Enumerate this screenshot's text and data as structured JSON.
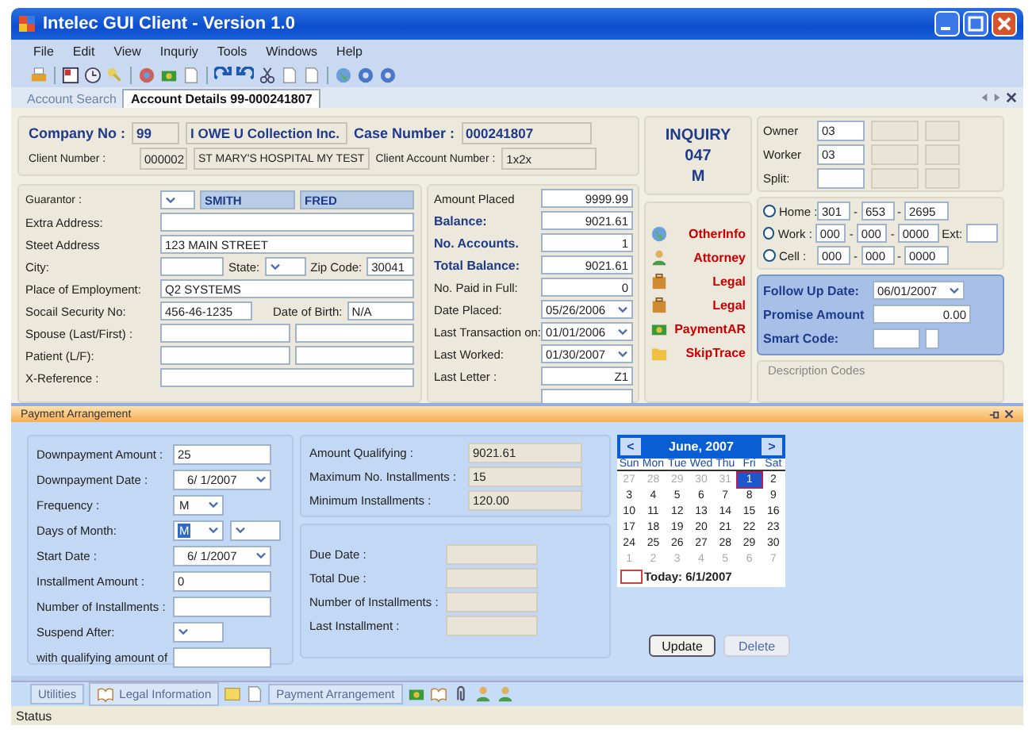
{
  "window": {
    "title": "Intelec GUI Client - Version 1.0"
  },
  "menu": [
    "File",
    "Edit",
    "View",
    "Inquriy",
    "Tools",
    "Windows",
    "Help"
  ],
  "tabs": [
    {
      "label": "Account Search",
      "selected": false
    },
    {
      "label": "Account Details 99-000241807",
      "selected": true
    }
  ],
  "header": {
    "company_label": "Company No :",
    "company_no": "99",
    "company_name": "I OWE U Collection Inc.",
    "case_label": "Case Number :",
    "case_number": "000241807",
    "client_label": "Client Number :",
    "client_number": "000002",
    "client_name": "ST MARY'S HOSPITAL  MY TEST",
    "client_account_label": "Client Account Number :",
    "client_account": "1x2x"
  },
  "guarantor": {
    "label": "Guarantor :",
    "last": "SMITH",
    "first": "FRED"
  },
  "address": [
    {
      "kind": "text",
      "label": "Extra Address:"
    },
    {
      "kind": "text",
      "label": "Steet Address",
      "value": "123 MAIN STREET"
    },
    {
      "kind": "city",
      "label": "City:",
      "state_label": "State:",
      "zip_label": "Zip Code:",
      "zip": "30041"
    },
    {
      "kind": "text",
      "label": "Place of Employment:",
      "value": "Q2 SYSTEMS"
    },
    {
      "kind": "ssn",
      "label": "Socail Security No:",
      "value": "456-46-1235",
      "dob_label": "Date of Birth:",
      "dob": "N/A"
    },
    {
      "kind": "pair",
      "label": "Spouse (Last/First) :"
    },
    {
      "kind": "pair",
      "label": "Patient (L/F):"
    },
    {
      "kind": "text",
      "label": "X-Reference :"
    }
  ],
  "amounts": [
    {
      "kind": "text",
      "label": "Amount Placed",
      "value": "9999.99",
      "emphasis": false
    },
    {
      "kind": "text",
      "label": "Balance:",
      "value": "9021.61",
      "emphasis": true
    },
    {
      "kind": "text",
      "label": "No. Accounts.",
      "value": "1",
      "emphasis": true
    },
    {
      "kind": "text",
      "label": "Total Balance:",
      "value": "9021.61",
      "emphasis": true
    },
    {
      "kind": "text",
      "label": "No. Paid in Full:",
      "value": "0",
      "emphasis": false
    },
    {
      "kind": "date",
      "label": "Date Placed:",
      "value": "05/26/2006",
      "emphasis": false
    },
    {
      "kind": "date",
      "label": "Last Transaction on:",
      "value": "01/01/2006",
      "emphasis": false
    },
    {
      "kind": "date",
      "label": "Last Worked:",
      "value": "01/30/2007",
      "emphasis": false
    },
    {
      "kind": "text",
      "label": "Last Letter :",
      "value": "Z1",
      "emphasis": false
    }
  ],
  "inquiry": [
    "INQUIRY",
    "047",
    "M"
  ],
  "assignment": [
    {
      "label": "Owner",
      "value": "03"
    },
    {
      "label": "Worker",
      "value": "03"
    },
    {
      "label": "Split:"
    }
  ],
  "links": [
    {
      "label": "OtherInfo",
      "kind": "globe"
    },
    {
      "label": "Attorney",
      "kind": "person"
    },
    {
      "label": "Legal",
      "kind": "briefcase"
    },
    {
      "label": "Legal",
      "kind": "briefcase"
    },
    {
      "label": "PaymentAR",
      "kind": "money"
    },
    {
      "label": "SkipTrace",
      "kind": "folder"
    }
  ],
  "phones": {
    "separator": "-",
    "items": [
      {
        "label": "Home :",
        "selected": false,
        "parts": [
          "301",
          "653",
          "2695"
        ]
      },
      {
        "label": "Work :",
        "selected": false,
        "parts": [
          "000",
          "000",
          "0000"
        ],
        "ext_label": "Ext:"
      },
      {
        "label": "Cell   :",
        "selected": false,
        "parts": [
          "000",
          "000",
          "0000"
        ]
      }
    ]
  },
  "follow_up": {
    "date_label": "Follow Up Date:",
    "date": "06/01/2007",
    "promise_label": "Promise Amount",
    "promise": "0.00",
    "smart_label": "Smart Code:"
  },
  "description_codes": {
    "label": "Description Codes"
  },
  "payment": {
    "title": "Payment Arrangement",
    "fields": [
      {
        "kind": "text",
        "label": "Downpayment Amount :",
        "value": "25"
      },
      {
        "kind": "date",
        "label": "Downpayment Date :",
        "value": "6/ 1/2007"
      },
      {
        "kind": "select",
        "label": "Frequency :",
        "value": "M",
        "highlighted": false
      },
      {
        "kind": "select2",
        "label": "Days of Month:",
        "value": "M",
        "highlighted": true
      },
      {
        "kind": "date",
        "label": "Start Date :",
        "value": "6/ 1/2007"
      },
      {
        "kind": "text",
        "label": "Installment Amount :",
        "value": "0"
      },
      {
        "kind": "text",
        "label": "Number of Installments :"
      },
      {
        "kind": "select",
        "label": "Suspend After:"
      },
      {
        "kind": "text",
        "label": "with qualifying amount of"
      }
    ],
    "qualifying": [
      {
        "label": "Amount Qualifying :",
        "value": "9021.61"
      },
      {
        "label": "Maximum No. Installments :",
        "value": "15"
      },
      {
        "label": "Minimum Installments :",
        "value": "120.00"
      }
    ],
    "due": [
      {
        "label": "Due Date :"
      },
      {
        "label": "Total Due :"
      },
      {
        "label": "Number of Installments :"
      },
      {
        "label": "Last Installment :"
      }
    ],
    "calendar": {
      "prev": "<",
      "next": ">",
      "month": "June, 2007",
      "weekdays": [
        "Sun",
        "Mon",
        "Tue",
        "Wed",
        "Thu",
        "Fri",
        "Sat"
      ],
      "weeks": [
        [
          {
            "d": "27",
            "other": true,
            "selected": false
          },
          {
            "d": "28",
            "other": true,
            "selected": false
          },
          {
            "d": "29",
            "other": true,
            "selected": false
          },
          {
            "d": "30",
            "other": true,
            "selected": false
          },
          {
            "d": "31",
            "other": true,
            "selected": false
          },
          {
            "d": "1",
            "other": false,
            "selected": true
          },
          {
            "d": "2",
            "other": false,
            "selected": false
          }
        ],
        [
          {
            "d": "3",
            "other": false,
            "selected": false
          },
          {
            "d": "4",
            "other": false,
            "selected": false
          },
          {
            "d": "5",
            "other": false,
            "selected": false
          },
          {
            "d": "6",
            "other": false,
            "selected": false
          },
          {
            "d": "7",
            "other": false,
            "selected": false
          },
          {
            "d": "8",
            "other": false,
            "selected": false
          },
          {
            "d": "9",
            "other": false,
            "selected": false
          }
        ],
        [
          {
            "d": "10",
            "other": false,
            "selected": false
          },
          {
            "d": "11",
            "other": false,
            "selected": false
          },
          {
            "d": "12",
            "other": false,
            "selected": false
          },
          {
            "d": "13",
            "other": false,
            "selected": false
          },
          {
            "d": "14",
            "other": false,
            "selected": false
          },
          {
            "d": "15",
            "other": false,
            "selected": false
          },
          {
            "d": "16",
            "other": false,
            "selected": false
          }
        ],
        [
          {
            "d": "17",
            "other": false,
            "selected": false
          },
          {
            "d": "18",
            "other": false,
            "selected": false
          },
          {
            "d": "19",
            "other": false,
            "selected": false
          },
          {
            "d": "20",
            "other": false,
            "selected": false
          },
          {
            "d": "21",
            "other": false,
            "selected": false
          },
          {
            "d": "22",
            "other": false,
            "selected": false
          },
          {
            "d": "23",
            "other": false,
            "selected": false
          }
        ],
        [
          {
            "d": "24",
            "other": false,
            "selected": false
          },
          {
            "d": "25",
            "other": false,
            "selected": false
          },
          {
            "d": "26",
            "other": false,
            "selected": false
          },
          {
            "d": "27",
            "other": false,
            "selected": false
          },
          {
            "d": "28",
            "other": false,
            "selected": false
          },
          {
            "d": "29",
            "other": false,
            "selected": false
          },
          {
            "d": "30",
            "other": false,
            "selected": false
          }
        ],
        [
          {
            "d": "1",
            "other": true,
            "selected": false
          },
          {
            "d": "2",
            "other": true,
            "selected": false
          },
          {
            "d": "3",
            "other": true,
            "selected": false
          },
          {
            "d": "4",
            "other": true,
            "selected": false
          },
          {
            "d": "5",
            "other": true,
            "selected": false
          },
          {
            "d": "6",
            "other": true,
            "selected": false
          },
          {
            "d": "7",
            "other": true,
            "selected": false
          }
        ]
      ],
      "today": "Today: 6/1/2007"
    },
    "buttons": [
      {
        "label": "Update",
        "disabled": false
      },
      {
        "label": "Delete",
        "disabled": true
      }
    ]
  },
  "bottom_tabs": [
    {
      "kind": "tab",
      "label": "Utilities"
    },
    {
      "kind": "booktab",
      "label": "Legal Information"
    },
    {
      "kind": "note"
    },
    {
      "kind": "doc"
    },
    {
      "kind": "tab",
      "label": "Payment Arrangement"
    },
    {
      "kind": "money"
    },
    {
      "kind": "book"
    },
    {
      "kind": "clip"
    },
    {
      "kind": "person"
    },
    {
      "kind": "person"
    }
  ],
  "status": "Status"
}
